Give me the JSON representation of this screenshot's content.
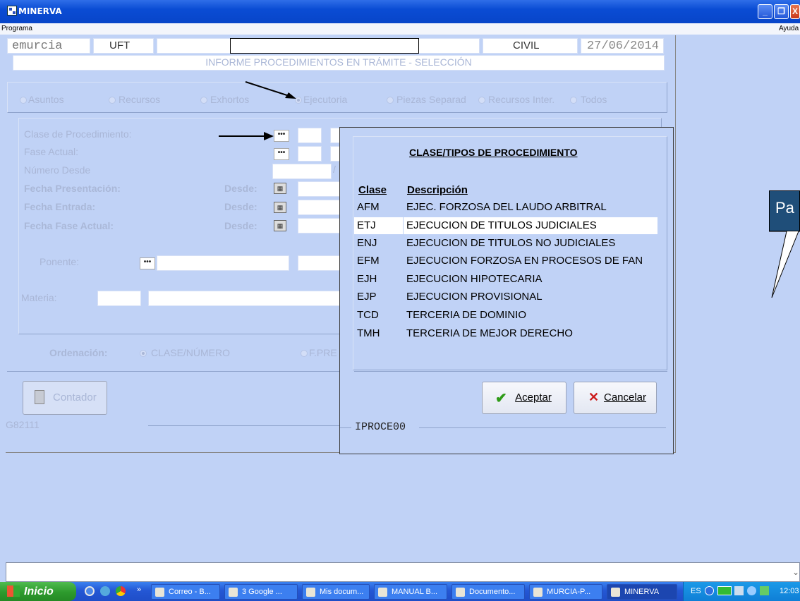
{
  "window": {
    "title": "MINERVA"
  },
  "menu": {
    "left": "Programa",
    "right": "Ayuda"
  },
  "header": {
    "user": "emurcia",
    "office": "UFT",
    "type": "CIVIL",
    "date": "27/06/2014",
    "subtitle": "INFORME PROCEDIMIENTOS EN TRÁMITE - SELECCIÓN"
  },
  "radios": [
    "Asuntos",
    "Recursos",
    "Exhortos",
    "Ejecutoria",
    "Piezas Separad",
    "Recursos Inter.",
    "Todos"
  ],
  "filters": {
    "clase": "Clase de Procedimiento:",
    "fase": "Fase Actual:",
    "numero": "Número Desde",
    "fecha_pres": "Fecha Presentación:",
    "fecha_entrada": "Fecha Entrada:",
    "fecha_fase": "Fecha Fase Actual:",
    "desde": "Desde:",
    "ponente": "Ponente:",
    "materia": "Materia:"
  },
  "ordenacion": {
    "label": "Ordenación:",
    "opt1": "CLASE/NÚMERO",
    "opt2": "F.PRE"
  },
  "contador": {
    "label": "Contador"
  },
  "form_code": "G82111",
  "dots": "•••",
  "slash": "/",
  "dialog": {
    "title": "CLASE/TIPOS DE PROCEDIMIENTO",
    "col_clase": "Clase",
    "col_desc": "Descripción",
    "rows": [
      {
        "code": "AFM",
        "desc": "EJEC. FORZOSA DEL LAUDO ARBITRAL"
      },
      {
        "code": "ETJ",
        "desc": "EJECUCION DE TITULOS JUDICIALES"
      },
      {
        "code": "ENJ",
        "desc": "EJECUCION DE TITULOS NO JUDICIALES"
      },
      {
        "code": "EFM",
        "desc": "EJECUCION FORZOSA EN PROCESOS DE FAN"
      },
      {
        "code": "EJH",
        "desc": "EJECUCION HIPOTECARIA"
      },
      {
        "code": "EJP",
        "desc": "EJECUCION PROVISIONAL"
      },
      {
        "code": "TCD",
        "desc": "TERCERIA DE DOMINIO"
      },
      {
        "code": "TMH",
        "desc": "TERCERIA DE MEJOR DERECHO"
      }
    ],
    "accept": "Aceptar",
    "cancel": "Cancelar",
    "code": "IPROCE00"
  },
  "callout": {
    "text": "Pa"
  },
  "taskbar": {
    "start": "Inicio",
    "tasks": [
      "Correo - B...",
      "3 Google ...",
      "Mis docum...",
      "MANUAL B...",
      "Documento...",
      "MURCIA-P...",
      "MINERVA"
    ],
    "lang": "ES",
    "time": "12:03"
  },
  "colors": {
    "accent": "#0a4cd4",
    "background": "#c0d2f6"
  }
}
